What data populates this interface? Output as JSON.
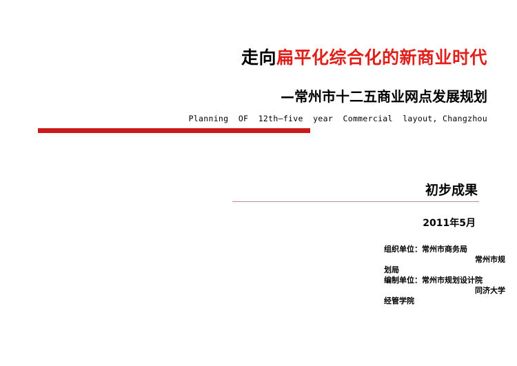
{
  "title": {
    "prefix": "走向",
    "highlight": "扁平化综合化的新商业时代"
  },
  "subtitle": "—常州市十二五商业网点发展规划",
  "english_title": "Planning  OF  12th—five  year  Commercial  layout, Changzhou",
  "section_heading": "初步成果",
  "date": "2011年5月",
  "credits": {
    "org_label": "组织单位：常州市商务局",
    "org_line2": "常州市规",
    "org_line3": "划局",
    "compile_label": "编制单位：常州市规划设计院",
    "compile_line2": "同济大学",
    "compile_line3": "经管学院"
  },
  "colors": {
    "accent_red": "#e0201a",
    "bar_red": "#cc1a1a",
    "underline": "#c88a8a"
  }
}
